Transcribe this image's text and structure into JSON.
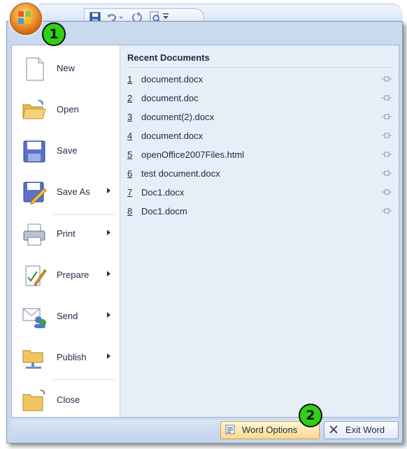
{
  "quick_access": {
    "buttons": [
      "save-icon",
      "undo-icon",
      "redo-icon",
      "print-preview-icon",
      "customize-qat-icon"
    ]
  },
  "badges": {
    "one": "1",
    "two": "2"
  },
  "left_menu": [
    {
      "label": "New",
      "icon": "new-document-icon",
      "submenu": false
    },
    {
      "label": "Open",
      "icon": "open-folder-icon",
      "submenu": false
    },
    {
      "label": "Save",
      "icon": "save-floppy-icon",
      "submenu": false
    },
    {
      "label": "Save As",
      "icon": "save-as-icon",
      "submenu": true
    },
    {
      "label": "Print",
      "icon": "printer-icon",
      "submenu": true
    },
    {
      "label": "Prepare",
      "icon": "prepare-icon",
      "submenu": true
    },
    {
      "label": "Send",
      "icon": "send-icon",
      "submenu": true
    },
    {
      "label": "Publish",
      "icon": "publish-icon",
      "submenu": true
    },
    {
      "label": "Close",
      "icon": "close-folder-icon",
      "submenu": false
    }
  ],
  "recent": {
    "header": "Recent Documents",
    "documents": [
      {
        "num": "1",
        "name": "document.docx"
      },
      {
        "num": "2",
        "name": "document.doc"
      },
      {
        "num": "3",
        "name": "document(2).docx"
      },
      {
        "num": "4",
        "name": "document.docx"
      },
      {
        "num": "5",
        "name": "openOffice2007Files.html"
      },
      {
        "num": "6",
        "name": "test document.docx"
      },
      {
        "num": "7",
        "name": "Doc1.docx"
      },
      {
        "num": "8",
        "name": "Doc1.docm"
      }
    ]
  },
  "bottom": {
    "word_options": "Word Options",
    "exit_word": "Exit Word"
  }
}
